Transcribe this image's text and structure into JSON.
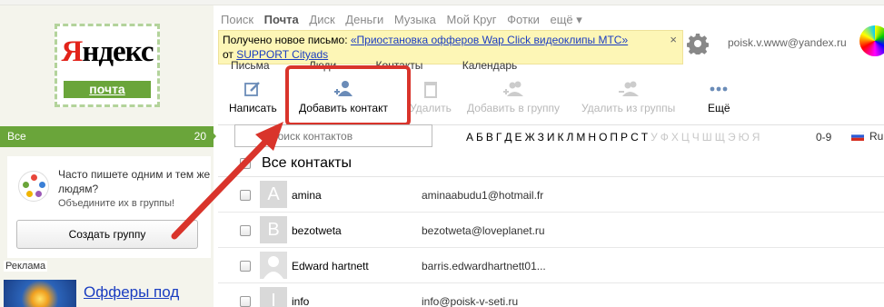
{
  "logo": {
    "brand_red": "Я",
    "brand_rest": "ндекс",
    "sub": "почта"
  },
  "topnav": {
    "items": [
      "Поиск",
      "Почта",
      "Диск",
      "Деньги",
      "Музыка",
      "Мой Круг",
      "Фотки",
      "ещё ▾"
    ],
    "active_index": 1
  },
  "notification": {
    "prefix": "Получено новое письмо: ",
    "link": "«Приостановка офферов Wap Click видеоклипы МТС»",
    "from_prefix": "от ",
    "from": "SUPPORT Cityads",
    "close": "×"
  },
  "account": {
    "email": "poisk.v.www@yandex.ru"
  },
  "subtabs": [
    "Письма",
    "Люди",
    "Контакты",
    "Календарь"
  ],
  "toolbar": {
    "write": "Написать",
    "add_contact": "Добавить контакт",
    "delete": "Удалить",
    "add_to_group": "Добавить в группу",
    "remove_from_group": "Удалить из группы",
    "more": "Ещё"
  },
  "sidebar": {
    "all_label": "Все",
    "all_count": "20",
    "group_text": "Часто пишете одним и тем же людям?",
    "group_sub": "Объедините их в группы!",
    "create_group": "Создать группу",
    "ad_label": "Реклама",
    "ad_link": "Офферы под"
  },
  "search": {
    "placeholder": "Поиск контактов"
  },
  "alphabet": {
    "letters": [
      "А",
      "Б",
      "В",
      "Г",
      "Д",
      "Е",
      "Ж",
      "З",
      "И",
      "К",
      "Л",
      "М",
      "Н",
      "О",
      "П",
      "Р",
      "С",
      "Т",
      "У",
      "Ф",
      "Х",
      "Ц",
      "Ч",
      "Ш",
      "Щ",
      "Э",
      "Ю",
      "Я"
    ],
    "active": [
      "А",
      "Б",
      "В",
      "Г",
      "Д",
      "Е",
      "Ж",
      "З",
      "И",
      "К",
      "Л",
      "М",
      "Н",
      "О",
      "П",
      "Р",
      "С",
      "Т"
    ],
    "digits": "0-9",
    "lang": "Ru"
  },
  "contacts": {
    "header": "Все контакты",
    "rows": [
      {
        "letter": "A",
        "name": "amina",
        "email": "aminaabudu1@hotmail.fr"
      },
      {
        "letter": "B",
        "name": "bezotweta",
        "email": "bezotweta@loveplanet.ru"
      },
      {
        "letter": "",
        "name": "Edward hartnett",
        "email": "barris.edwardhartnett01..."
      },
      {
        "letter": "I",
        "name": "info",
        "email": "info@poisk-v-seti.ru"
      }
    ]
  },
  "colors": {
    "green": "#6aa53a",
    "highlight_red": "#d9342b",
    "notif_bg": "#fdf6b6",
    "link": "#1a3dc1"
  }
}
